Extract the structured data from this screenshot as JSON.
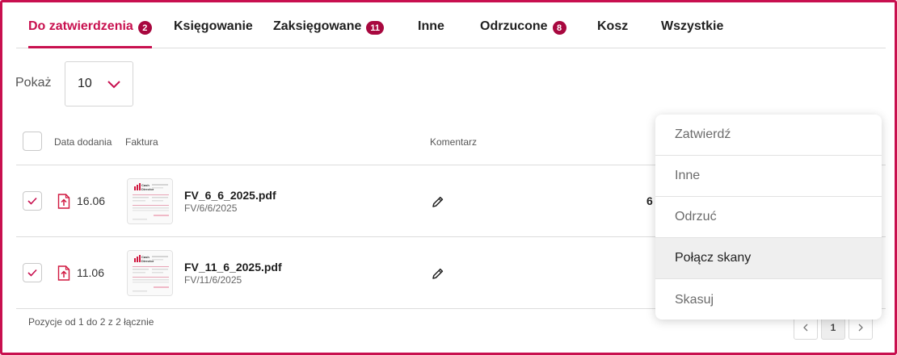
{
  "tabs": [
    {
      "label": "Do zatwierdzenia",
      "badge": "2"
    },
    {
      "label": "Księgowanie",
      "badge": ""
    },
    {
      "label": "Zaksięgowane",
      "badge": "11"
    },
    {
      "label": "Inne",
      "badge": ""
    },
    {
      "label": "Odrzucone",
      "badge": "8"
    },
    {
      "label": "Kosz",
      "badge": ""
    },
    {
      "label": "Wszystkie",
      "badge": ""
    }
  ],
  "page_size": {
    "label": "Pokaż",
    "value": "10"
  },
  "table": {
    "headers": {
      "date": "Data dodania",
      "invoice": "Faktura",
      "comment": "Komentarz"
    },
    "rows": [
      {
        "date": "16.06",
        "file_name": "FV_6_6_2025.pdf",
        "invoice_number": "FV/6/6/2025",
        "cut_text": "6"
      },
      {
        "date": "11.06",
        "file_name": "FV_11_6_2025.pdf",
        "invoice_number": "FV/11/6/2025",
        "cut_text": ""
      }
    ]
  },
  "footer": {
    "summary": "Pozycje od 1 do 2 z 2 łącznie"
  },
  "pagination": {
    "current": "1"
  },
  "menu": {
    "items": [
      "Zatwierdź",
      "Inne",
      "Odrzuć",
      "Połącz skany",
      "Skasuj"
    ],
    "hovered_item": "Połącz skany"
  },
  "colors": {
    "accent": "#c8104f",
    "badge": "#a8083f"
  },
  "thumbnail": {
    "brand_line1": "Cash",
    "brand_line2": "Director"
  }
}
